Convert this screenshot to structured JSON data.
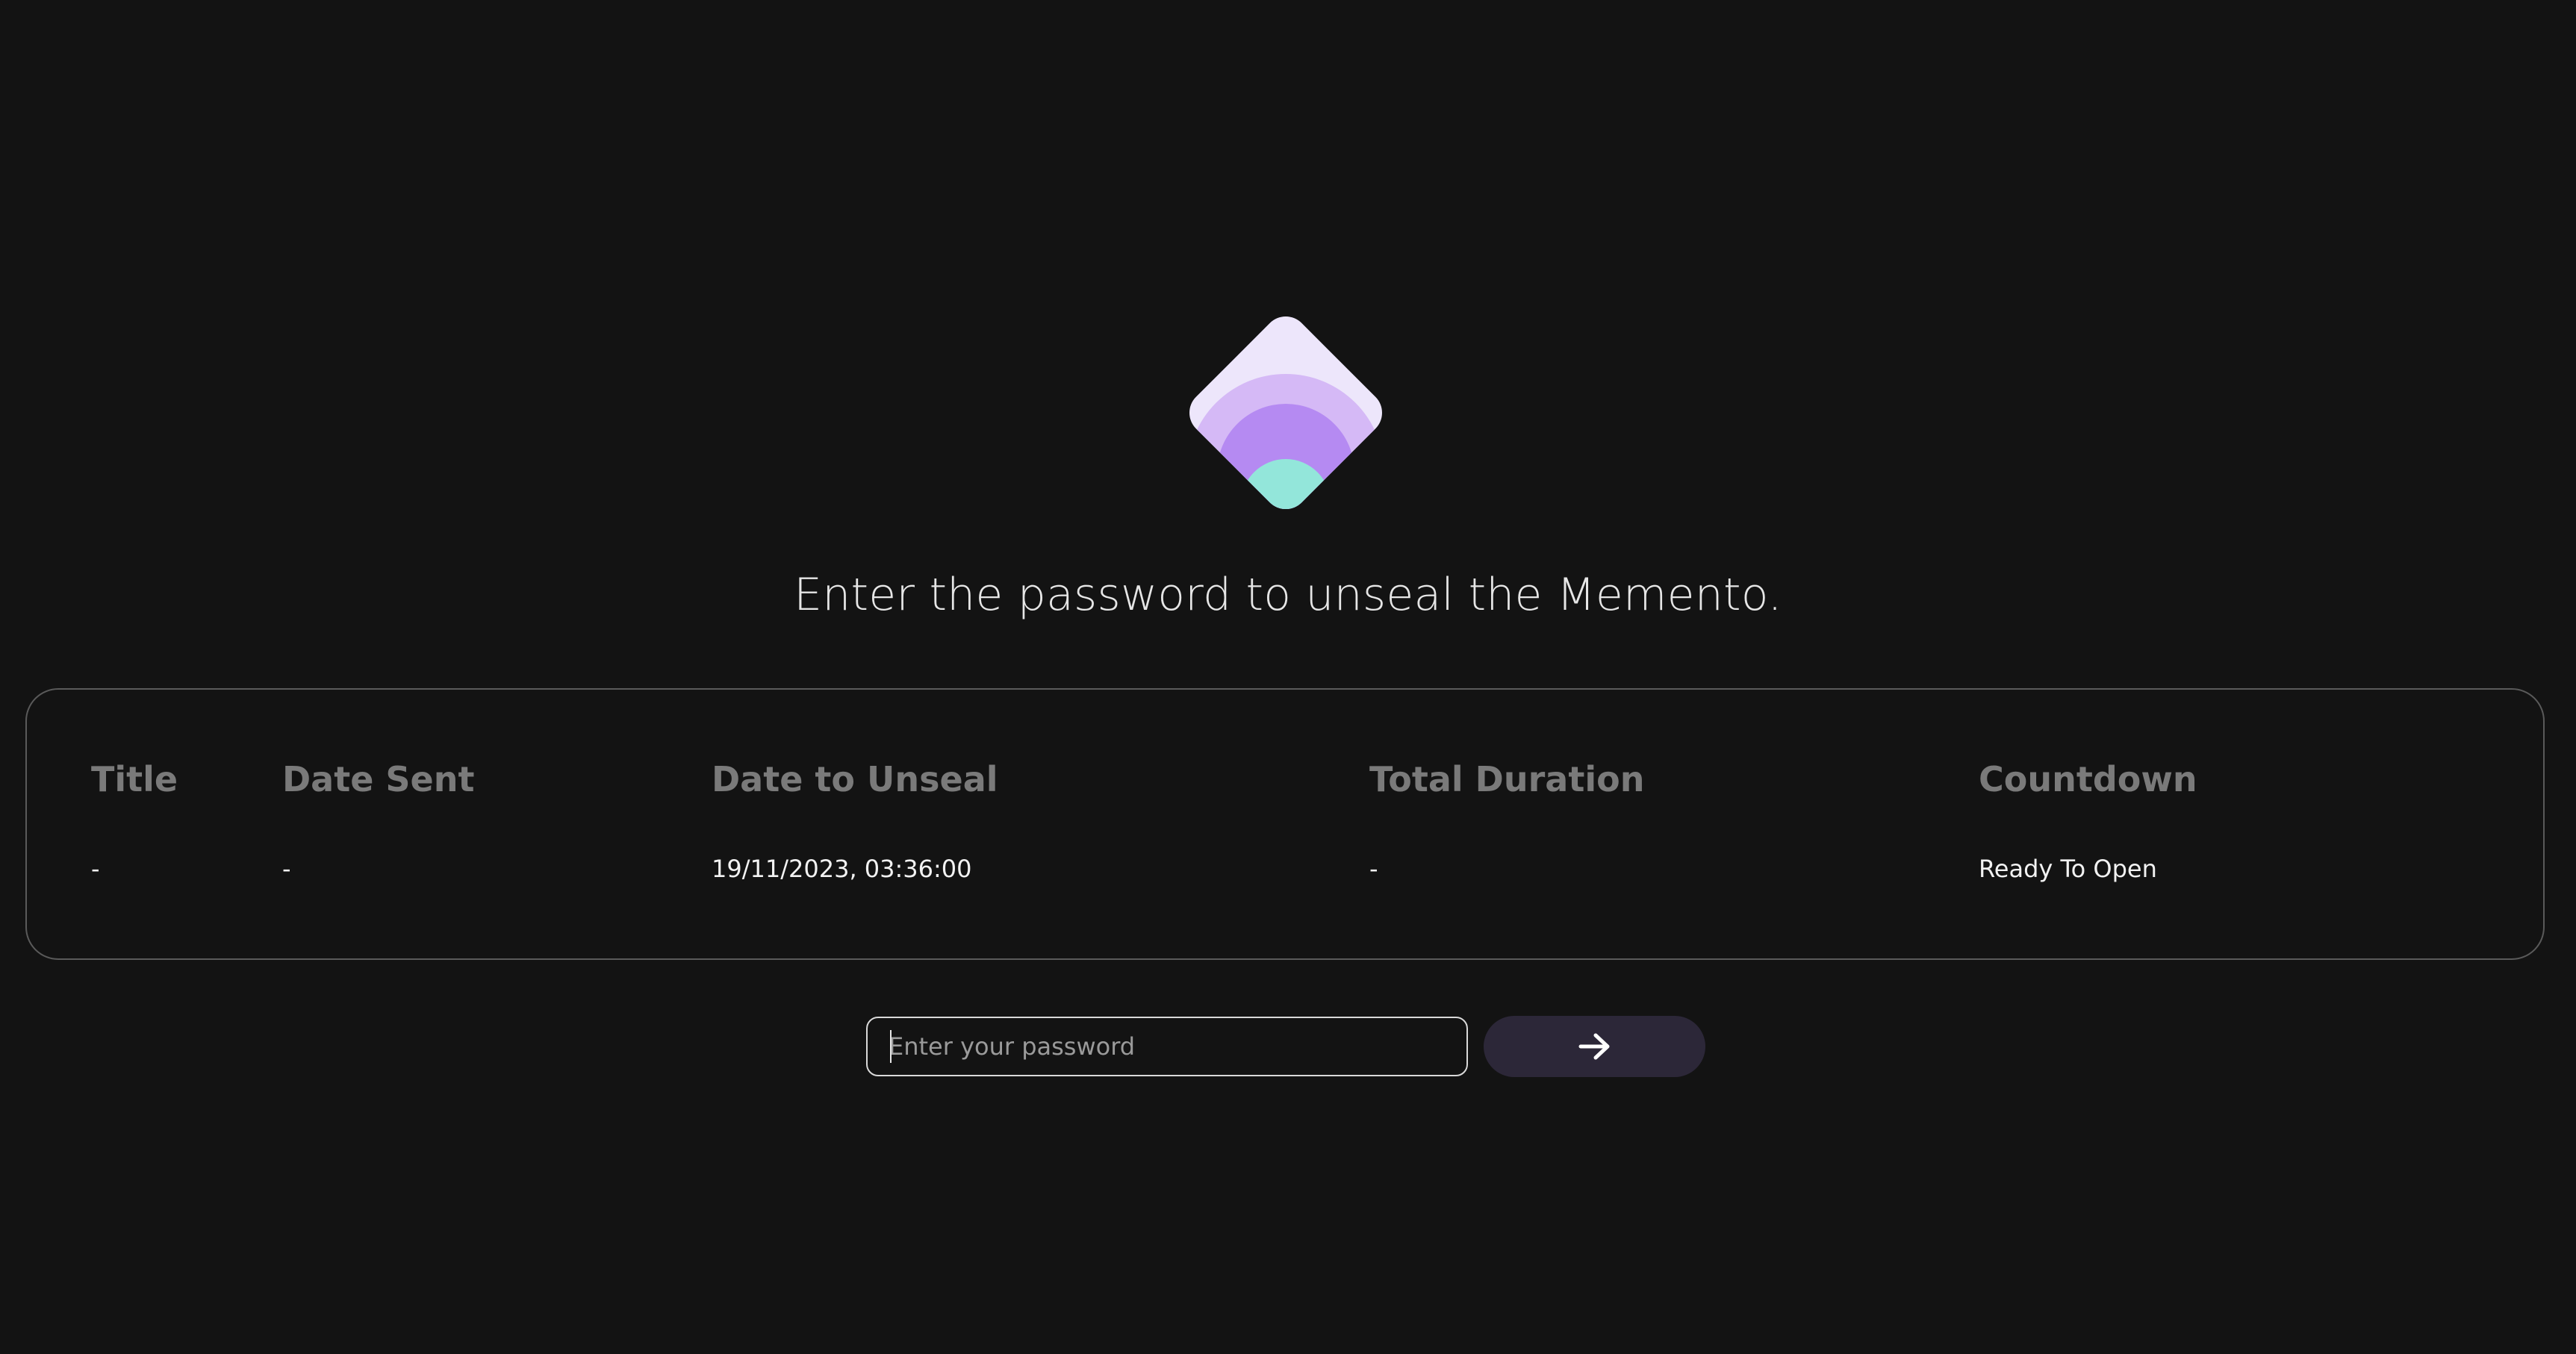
{
  "logo": {
    "icon": "memento-diamond-logo-icon",
    "colors": {
      "outer": "#ede6fb",
      "ring1": "#d5b9f6",
      "ring2": "#b58af2",
      "center": "#93e6da"
    }
  },
  "headline": "Enter the password to unseal the Memento.",
  "table": {
    "headers": {
      "title": "Title",
      "date_sent": "Date Sent",
      "date_to_unseal": "Date to Unseal",
      "total_duration": "Total Duration",
      "countdown": "Countdown"
    },
    "row": {
      "title": "-",
      "date_sent": "-",
      "date_to_unseal": "19/11/2023, 03:36:00",
      "total_duration": "-",
      "countdown": "Ready To Open"
    }
  },
  "password": {
    "placeholder": "Enter your password",
    "value": ""
  },
  "submit": {
    "icon": "arrow-right-icon",
    "color": "#2c2738"
  },
  "colors": {
    "background": "#131313",
    "border": "#5a5a5a",
    "header_text": "#7a7a7a",
    "value_text": "#f2f2f2"
  }
}
